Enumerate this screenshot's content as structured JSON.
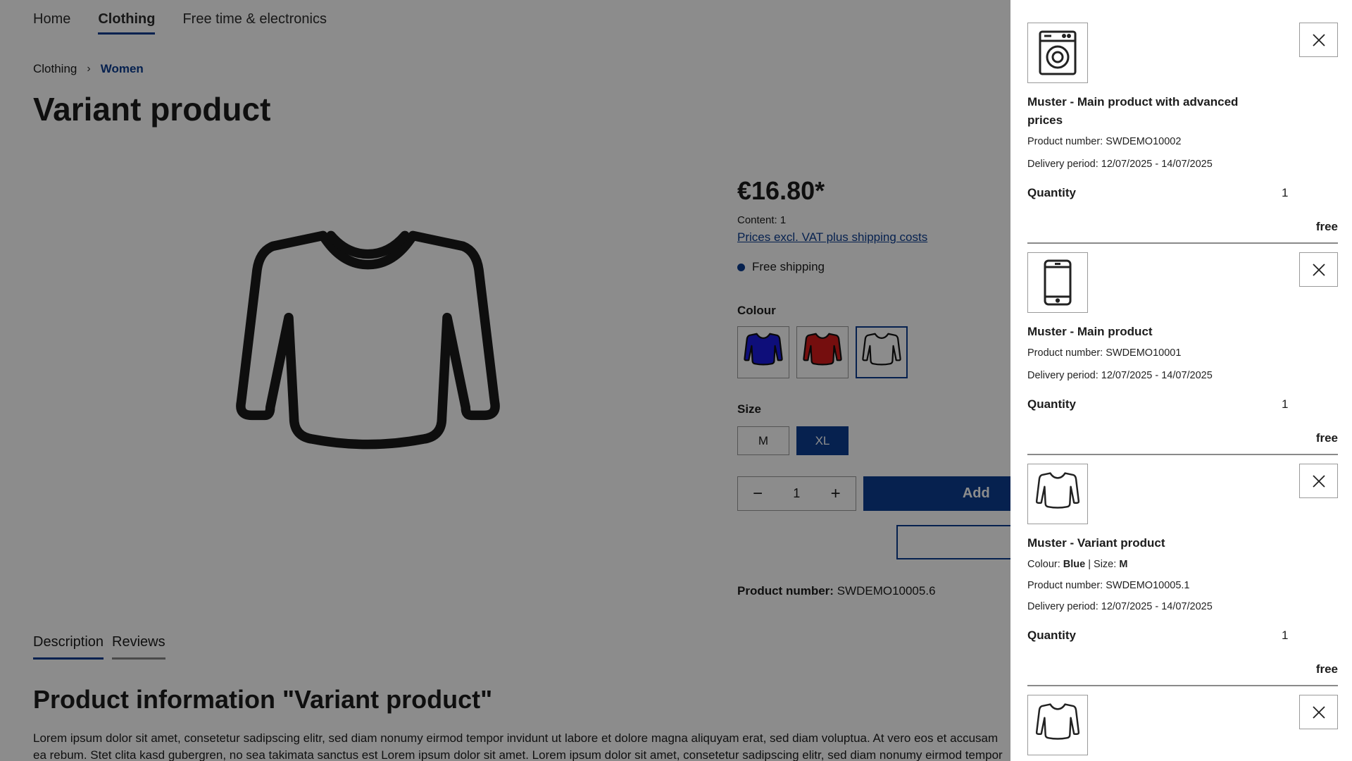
{
  "nav": [
    {
      "label": "Home",
      "active": false
    },
    {
      "label": "Clothing",
      "active": true
    },
    {
      "label": "Free time & electronics",
      "active": false
    }
  ],
  "breadcrumb": {
    "parent": "Clothing",
    "separator": "›",
    "current": "Women"
  },
  "page_title": "Variant product",
  "buybox": {
    "price": "€16.80*",
    "content": "Content: 1",
    "vat_link": "Prices excl. VAT plus shipping costs",
    "shipping": "Free shipping",
    "colour_label": "Colour",
    "colours": [
      "Blue",
      "Red",
      "White"
    ],
    "size_label": "Size",
    "sizes": [
      "M",
      "XL"
    ],
    "selected_size": "XL",
    "quantity": "1",
    "add_button": "Add",
    "product_number_label": "Product number:",
    "product_number": "SWDEMO10005.6"
  },
  "tabs": [
    "Description",
    "Reviews"
  ],
  "info_title": "Product information \"Variant product\"",
  "lorem_lines": [
    "Lorem ipsum dolor sit amet, consetetur sadipscing elitr, sed diam nonumy eirmod tempor invidunt ut labore et dolore magna aliquyam erat, sed diam voluptua. At vero eos et accusam",
    "ea rebum. Stet clita kasd gubergren, no sea takimata sanctus est Lorem ipsum dolor sit amet. Lorem ipsum dolor sit amet, consetetur sadipscing elitr, sed diam nonumy eirmod tempor"
  ],
  "cart": {
    "items": [
      {
        "icon": "washing-machine-icon",
        "name": "Muster - Main product with advanced prices",
        "product_number": "Product number: SWDEMO10002",
        "delivery": "Delivery period: 12/07/2025 - 14/07/2025",
        "quantity_label": "Quantity",
        "quantity": "1",
        "price": "free"
      },
      {
        "icon": "smartphone-icon",
        "name": "Muster - Main product",
        "product_number": "Product number: SWDEMO10001",
        "delivery": "Delivery period: 12/07/2025 - 14/07/2025",
        "quantity_label": "Quantity",
        "quantity": "1",
        "price": "free"
      },
      {
        "icon": "shirt-icon",
        "name": "Muster - Variant product",
        "colour_label": "Colour:",
        "colour": "Blue",
        "size_label": "Size:",
        "size": "M",
        "product_number": "Product number: SWDEMO10005.1",
        "delivery": "Delivery period: 12/07/2025 - 14/07/2025",
        "quantity_label": "Quantity",
        "quantity": "1",
        "price": "free"
      },
      {
        "icon": "shirt-icon"
      }
    ]
  },
  "colors": {
    "accent": "#0b3d91",
    "overlay": "rgba(0,0,0,0.45)",
    "swatch_blue": "#1a1adf",
    "swatch_red": "#d61b1b",
    "swatch_white": "#ffffff"
  }
}
